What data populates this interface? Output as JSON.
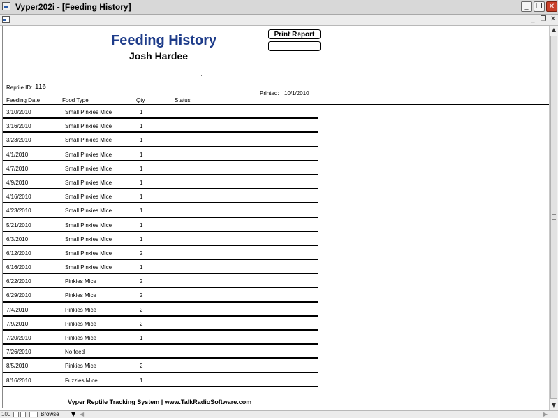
{
  "window": {
    "title": "Vyper202i - [Feeding History]",
    "min_glyph": "_",
    "max_glyph": "❐",
    "close_glyph": "✕"
  },
  "mdi": {
    "min_glyph": "_",
    "restore_glyph": "❐",
    "close_glyph": "✕"
  },
  "report": {
    "title": "Feeding History",
    "reptile_name": "Josh Hardee",
    "print_button_label": "Print Report",
    "reptile_id_label": "Reptile ID:",
    "reptile_id": "116",
    "printed_label": "Printed:",
    "printed_date": "10/1/2010",
    "columns": {
      "date": "Feeding Date",
      "food": "Food Type",
      "qty": "Qty",
      "status": "Status"
    },
    "rows": [
      {
        "date": "3/10/2010",
        "food": "Small Pinkies Mice",
        "qty": "1"
      },
      {
        "date": "3/16/2010",
        "food": "Small Pinkies Mice",
        "qty": "1"
      },
      {
        "date": "3/23/2010",
        "food": "Small Pinkies Mice",
        "qty": "1"
      },
      {
        "date": "4/1/2010",
        "food": "Small Pinkies Mice",
        "qty": "1"
      },
      {
        "date": "4/7/2010",
        "food": "Small Pinkies Mice",
        "qty": "1"
      },
      {
        "date": "4/9/2010",
        "food": "Small Pinkies Mice",
        "qty": "1"
      },
      {
        "date": "4/16/2010",
        "food": "Small Pinkies Mice",
        "qty": "1"
      },
      {
        "date": "4/23/2010",
        "food": "Small Pinkies Mice",
        "qty": "1"
      },
      {
        "date": "5/21/2010",
        "food": "Small Pinkies Mice",
        "qty": "1"
      },
      {
        "date": "6/3/2010",
        "food": "Small Pinkies Mice",
        "qty": "1"
      },
      {
        "date": "6/12/2010",
        "food": "Small Pinkies Mice",
        "qty": "2"
      },
      {
        "date": "6/16/2010",
        "food": "Small Pinkies Mice",
        "qty": "1"
      },
      {
        "date": "6/22/2010",
        "food": "Pinkies Mice",
        "qty": "2"
      },
      {
        "date": "6/29/2010",
        "food": "Pinkies Mice",
        "qty": "2"
      },
      {
        "date": "7/4/2010",
        "food": "Pinkies Mice",
        "qty": "2"
      },
      {
        "date": "7/9/2010",
        "food": "Pinkies Mice",
        "qty": "2"
      },
      {
        "date": "7/20/2010",
        "food": "Pinkies Mice",
        "qty": "1"
      },
      {
        "date": "7/26/2010",
        "food": "No feed",
        "qty": ""
      },
      {
        "date": "8/5/2010",
        "food": "Pinkies Mice",
        "qty": "2"
      },
      {
        "date": "8/16/2010",
        "food": "Fuzzies Mice",
        "qty": "1"
      }
    ],
    "footer": "Vyper Reptile Tracking System | www.TalkRadioSoftware.com"
  },
  "scrollbar": {
    "up_glyph": "▲",
    "down_glyph": "▼"
  },
  "statusbar": {
    "zoom": "100",
    "mode": "Browse",
    "mode_arrow_glyph": "▼",
    "left_glyph": "◀",
    "right_glyph": "▶"
  },
  "colors": {
    "title_blue": "#1e3c8a",
    "close_red": "#c8402a"
  }
}
